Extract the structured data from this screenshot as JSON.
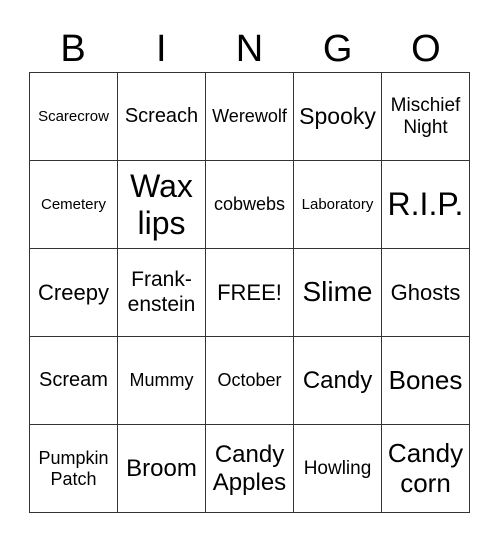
{
  "header": [
    "B",
    "I",
    "N",
    "G",
    "O"
  ],
  "cells": [
    [
      "Scarecrow",
      "Screach",
      "Werewolf",
      "Spooky",
      "Mischief Night"
    ],
    [
      "Cemetery",
      "Wax lips",
      "cobwebs",
      "Laboratory",
      "R.I.P."
    ],
    [
      "Creepy",
      "Frank- enstein",
      "FREE!",
      "Slime",
      "Ghosts"
    ],
    [
      "Scream",
      "Mummy",
      "October",
      "Candy",
      "Bones"
    ],
    [
      "Pumpkin Patch",
      "Broom",
      "Candy Apples",
      "Howling",
      "Candy corn"
    ]
  ]
}
